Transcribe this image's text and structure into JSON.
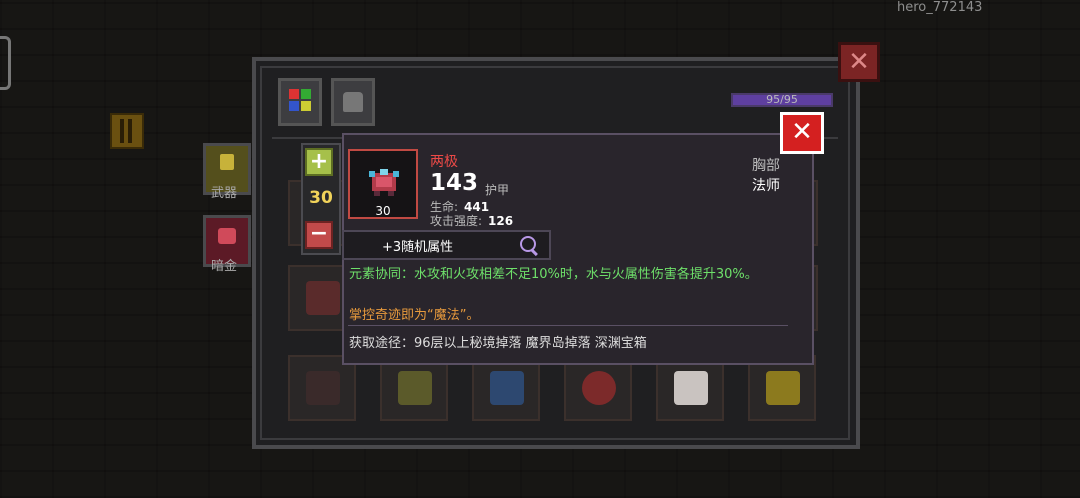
{
  "player": {
    "name": "hero_772143"
  },
  "panel": {
    "close_label": "✕",
    "tabs": [
      {
        "name": "grid-tab"
      },
      {
        "name": "armor-tab"
      }
    ],
    "xp": {
      "text": "95/95",
      "fraction": 1.0
    },
    "side_buttons": [
      {
        "label": "武器",
        "color": "#544f1c"
      },
      {
        "label": "暗金",
        "color": "#5c1a26"
      }
    ],
    "quantity": {
      "plus_label": "+",
      "value": "30",
      "minus_label": "−"
    },
    "slots": [
      {
        "icon": "dark-armor-icon",
        "color": "#5a2b2b"
      },
      {
        "icon": "goblin-armor-icon",
        "color": "#5b5a2a"
      },
      {
        "icon": "blue-robe-icon",
        "color": "#2d4870"
      },
      {
        "icon": "red-cloak-icon",
        "color": "#7c2a2a"
      },
      {
        "icon": "white-dress-icon",
        "color": "#c9c3c0"
      },
      {
        "icon": "yellow-tunic-icon",
        "color": "#8c7a1e"
      }
    ]
  },
  "tooltip": {
    "close_label": "✕",
    "item": {
      "name": "两极",
      "level": "30",
      "armor_value": "143",
      "armor_label": "护甲",
      "stats": [
        {
          "label": "生命:",
          "value": "441"
        },
        {
          "label": "攻击强度:",
          "value": "126"
        }
      ],
      "slot": "胸部",
      "class": "法师"
    },
    "random_attr": "+3随机属性",
    "effect_1": "元素协同：水攻和火攻相差不足10%时，水与火属性伤害各提升30%。",
    "effect_2": "掌控奇迹即为“魔法”。",
    "source": "获取途径：96层以上秘境掉落 魔界岛掉落 深渊宝箱"
  },
  "colors": {
    "legendary_name": "#ec4a47",
    "effect_green": "#6ee06a",
    "effect_orange": "#e79a3d",
    "quantity_yellow": "#f1d35a"
  }
}
